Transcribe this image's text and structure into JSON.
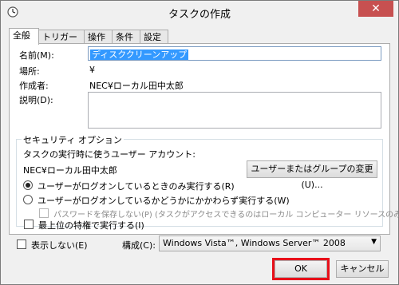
{
  "window": {
    "title": "タスクの作成",
    "close_glyph": "✕"
  },
  "tabs": [
    {
      "label": "全般",
      "active": true
    },
    {
      "label": "トリガー",
      "active": false
    },
    {
      "label": "操作",
      "active": false
    },
    {
      "label": "条件",
      "active": false
    },
    {
      "label": "設定",
      "active": false
    }
  ],
  "general": {
    "name_label": "名前(M):",
    "name_value": "ディスククリーンアップ",
    "location_label": "場所:",
    "location_value": "¥",
    "author_label": "作成者:",
    "author_value": "NEC¥ローカル田中太郎",
    "description_label": "説明(D):"
  },
  "security": {
    "legend": "セキュリティ オプション",
    "account_label": "タスクの実行時に使うユーザー アカウント:",
    "account_value": "NEC¥ローカル田中太郎",
    "change_button": "ユーザーまたはグループの変更(U)...",
    "radio_logged_on": "ユーザーがログオンしているときのみ実行する(R)",
    "radio_whether": "ユーザーがログオンしているかどうかにかかわらず実行する(W)",
    "no_store_password": "パスワードを保存しない(P) (タスクがアクセスできるのはローカル コンピューター リソースのみ)",
    "highest_privileges": "最上位の特権で実行する(I)"
  },
  "footer": {
    "hidden_label": "表示しない(E)",
    "configure_label": "構成(C):",
    "configure_value": "Windows Vista™, Windows Server™ 2008",
    "ok_button": "OK",
    "cancel_button": "キャンセル"
  },
  "colors": {
    "highlight": "#e8101a",
    "selection": "#3399ff",
    "close_button": "#c75050"
  }
}
